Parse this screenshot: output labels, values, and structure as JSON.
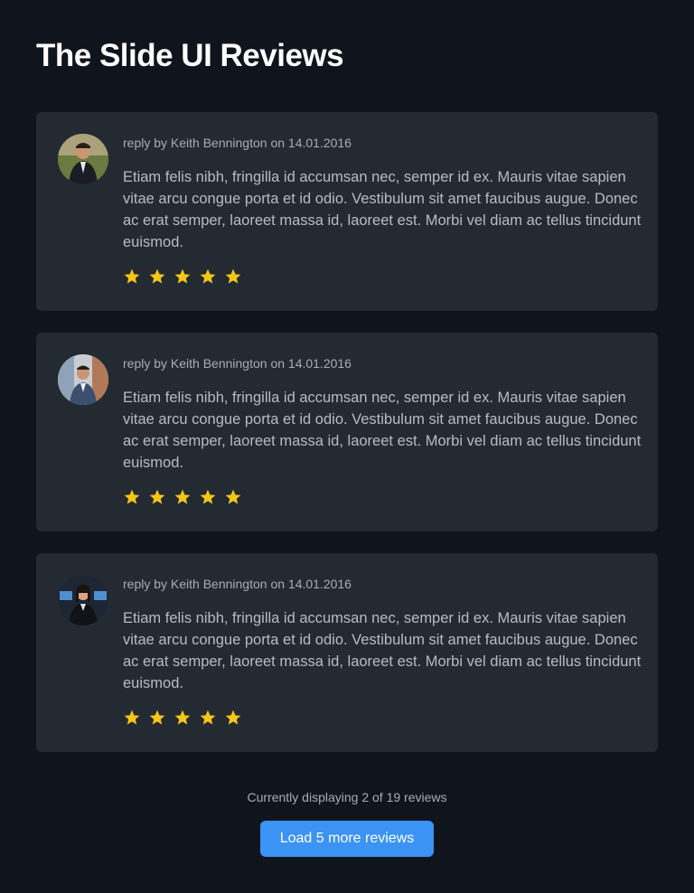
{
  "page": {
    "title": "The Slide UI Reviews"
  },
  "reviews": [
    {
      "meta": "reply by Keith Bennington on 14.01.2016",
      "text": "Etiam felis nibh, fringilla id accumsan nec, semper id ex. Mauris vitae sapien vitae arcu congue porta et id odio. Vestibulum sit amet faucibus augue. Donec ac erat semper, laoreet massa id, laoreet est. Morbi vel diam ac tellus tincidunt euismod.",
      "rating": 5
    },
    {
      "meta": "reply by Keith Bennington on 14.01.2016",
      "text": "Etiam felis nibh, fringilla id accumsan nec, semper id ex. Mauris vitae sapien vitae arcu congue porta et id odio. Vestibulum sit amet faucibus augue. Donec ac erat semper, laoreet massa id, laoreet est. Morbi vel diam ac tellus tincidunt euismod.",
      "rating": 5
    },
    {
      "meta": "reply by Keith Bennington on 14.01.2016",
      "text": "Etiam felis nibh, fringilla id accumsan nec, semper id ex. Mauris vitae sapien vitae arcu congue porta et id odio. Vestibulum sit amet faucibus augue. Donec ac erat semper, laoreet massa id, laoreet est. Morbi vel diam ac tellus tincidunt euismod.",
      "rating": 5
    }
  ],
  "footer": {
    "status": "Currently displaying 2 of 19 reviews",
    "load_more_label": "Load 5 more reviews"
  },
  "colors": {
    "background": "#0f141d",
    "card": "#232a32",
    "star": "#f5c518",
    "button": "#3b93f6"
  },
  "icons": {
    "star": "star-icon",
    "avatar": "avatar-photo"
  }
}
